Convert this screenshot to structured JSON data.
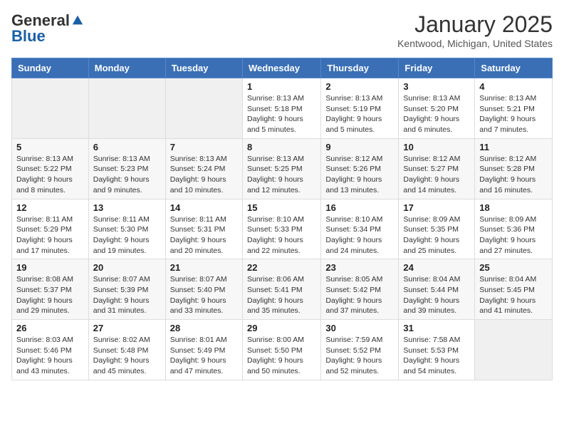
{
  "header": {
    "logo_general": "General",
    "logo_blue": "Blue",
    "title": "January 2025",
    "subtitle": "Kentwood, Michigan, United States"
  },
  "days_of_week": [
    "Sunday",
    "Monday",
    "Tuesday",
    "Wednesday",
    "Thursday",
    "Friday",
    "Saturday"
  ],
  "weeks": [
    [
      {
        "day": "",
        "sunrise": "",
        "sunset": "",
        "daylight": ""
      },
      {
        "day": "",
        "sunrise": "",
        "sunset": "",
        "daylight": ""
      },
      {
        "day": "",
        "sunrise": "",
        "sunset": "",
        "daylight": ""
      },
      {
        "day": "1",
        "sunrise": "Sunrise: 8:13 AM",
        "sunset": "Sunset: 5:18 PM",
        "daylight": "Daylight: 9 hours and 5 minutes."
      },
      {
        "day": "2",
        "sunrise": "Sunrise: 8:13 AM",
        "sunset": "Sunset: 5:19 PM",
        "daylight": "Daylight: 9 hours and 5 minutes."
      },
      {
        "day": "3",
        "sunrise": "Sunrise: 8:13 AM",
        "sunset": "Sunset: 5:20 PM",
        "daylight": "Daylight: 9 hours and 6 minutes."
      },
      {
        "day": "4",
        "sunrise": "Sunrise: 8:13 AM",
        "sunset": "Sunset: 5:21 PM",
        "daylight": "Daylight: 9 hours and 7 minutes."
      }
    ],
    [
      {
        "day": "5",
        "sunrise": "Sunrise: 8:13 AM",
        "sunset": "Sunset: 5:22 PM",
        "daylight": "Daylight: 9 hours and 8 minutes."
      },
      {
        "day": "6",
        "sunrise": "Sunrise: 8:13 AM",
        "sunset": "Sunset: 5:23 PM",
        "daylight": "Daylight: 9 hours and 9 minutes."
      },
      {
        "day": "7",
        "sunrise": "Sunrise: 8:13 AM",
        "sunset": "Sunset: 5:24 PM",
        "daylight": "Daylight: 9 hours and 10 minutes."
      },
      {
        "day": "8",
        "sunrise": "Sunrise: 8:13 AM",
        "sunset": "Sunset: 5:25 PM",
        "daylight": "Daylight: 9 hours and 12 minutes."
      },
      {
        "day": "9",
        "sunrise": "Sunrise: 8:12 AM",
        "sunset": "Sunset: 5:26 PM",
        "daylight": "Daylight: 9 hours and 13 minutes."
      },
      {
        "day": "10",
        "sunrise": "Sunrise: 8:12 AM",
        "sunset": "Sunset: 5:27 PM",
        "daylight": "Daylight: 9 hours and 14 minutes."
      },
      {
        "day": "11",
        "sunrise": "Sunrise: 8:12 AM",
        "sunset": "Sunset: 5:28 PM",
        "daylight": "Daylight: 9 hours and 16 minutes."
      }
    ],
    [
      {
        "day": "12",
        "sunrise": "Sunrise: 8:11 AM",
        "sunset": "Sunset: 5:29 PM",
        "daylight": "Daylight: 9 hours and 17 minutes."
      },
      {
        "day": "13",
        "sunrise": "Sunrise: 8:11 AM",
        "sunset": "Sunset: 5:30 PM",
        "daylight": "Daylight: 9 hours and 19 minutes."
      },
      {
        "day": "14",
        "sunrise": "Sunrise: 8:11 AM",
        "sunset": "Sunset: 5:31 PM",
        "daylight": "Daylight: 9 hours and 20 minutes."
      },
      {
        "day": "15",
        "sunrise": "Sunrise: 8:10 AM",
        "sunset": "Sunset: 5:33 PM",
        "daylight": "Daylight: 9 hours and 22 minutes."
      },
      {
        "day": "16",
        "sunrise": "Sunrise: 8:10 AM",
        "sunset": "Sunset: 5:34 PM",
        "daylight": "Daylight: 9 hours and 24 minutes."
      },
      {
        "day": "17",
        "sunrise": "Sunrise: 8:09 AM",
        "sunset": "Sunset: 5:35 PM",
        "daylight": "Daylight: 9 hours and 25 minutes."
      },
      {
        "day": "18",
        "sunrise": "Sunrise: 8:09 AM",
        "sunset": "Sunset: 5:36 PM",
        "daylight": "Daylight: 9 hours and 27 minutes."
      }
    ],
    [
      {
        "day": "19",
        "sunrise": "Sunrise: 8:08 AM",
        "sunset": "Sunset: 5:37 PM",
        "daylight": "Daylight: 9 hours and 29 minutes."
      },
      {
        "day": "20",
        "sunrise": "Sunrise: 8:07 AM",
        "sunset": "Sunset: 5:39 PM",
        "daylight": "Daylight: 9 hours and 31 minutes."
      },
      {
        "day": "21",
        "sunrise": "Sunrise: 8:07 AM",
        "sunset": "Sunset: 5:40 PM",
        "daylight": "Daylight: 9 hours and 33 minutes."
      },
      {
        "day": "22",
        "sunrise": "Sunrise: 8:06 AM",
        "sunset": "Sunset: 5:41 PM",
        "daylight": "Daylight: 9 hours and 35 minutes."
      },
      {
        "day": "23",
        "sunrise": "Sunrise: 8:05 AM",
        "sunset": "Sunset: 5:42 PM",
        "daylight": "Daylight: 9 hours and 37 minutes."
      },
      {
        "day": "24",
        "sunrise": "Sunrise: 8:04 AM",
        "sunset": "Sunset: 5:44 PM",
        "daylight": "Daylight: 9 hours and 39 minutes."
      },
      {
        "day": "25",
        "sunrise": "Sunrise: 8:04 AM",
        "sunset": "Sunset: 5:45 PM",
        "daylight": "Daylight: 9 hours and 41 minutes."
      }
    ],
    [
      {
        "day": "26",
        "sunrise": "Sunrise: 8:03 AM",
        "sunset": "Sunset: 5:46 PM",
        "daylight": "Daylight: 9 hours and 43 minutes."
      },
      {
        "day": "27",
        "sunrise": "Sunrise: 8:02 AM",
        "sunset": "Sunset: 5:48 PM",
        "daylight": "Daylight: 9 hours and 45 minutes."
      },
      {
        "day": "28",
        "sunrise": "Sunrise: 8:01 AM",
        "sunset": "Sunset: 5:49 PM",
        "daylight": "Daylight: 9 hours and 47 minutes."
      },
      {
        "day": "29",
        "sunrise": "Sunrise: 8:00 AM",
        "sunset": "Sunset: 5:50 PM",
        "daylight": "Daylight: 9 hours and 50 minutes."
      },
      {
        "day": "30",
        "sunrise": "Sunrise: 7:59 AM",
        "sunset": "Sunset: 5:52 PM",
        "daylight": "Daylight: 9 hours and 52 minutes."
      },
      {
        "day": "31",
        "sunrise": "Sunrise: 7:58 AM",
        "sunset": "Sunset: 5:53 PM",
        "daylight": "Daylight: 9 hours and 54 minutes."
      },
      {
        "day": "",
        "sunrise": "",
        "sunset": "",
        "daylight": ""
      }
    ]
  ]
}
